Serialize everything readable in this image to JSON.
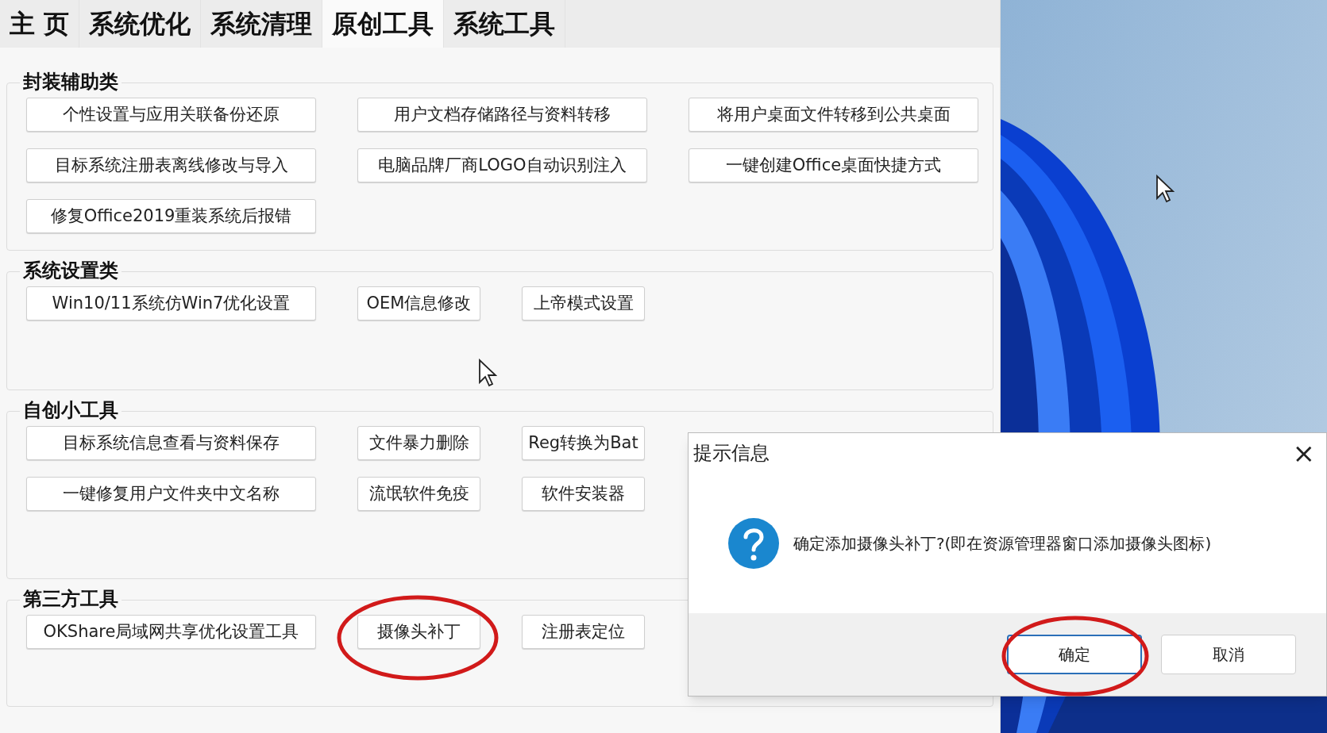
{
  "tabs": [
    {
      "label": "主 页",
      "selected": false
    },
    {
      "label": "系统优化",
      "selected": false
    },
    {
      "label": "系统清理",
      "selected": false
    },
    {
      "label": "原创工具",
      "selected": true
    },
    {
      "label": "系统工具",
      "selected": false
    }
  ],
  "sections": [
    {
      "title": "封装辅助类",
      "rows": [
        [
          {
            "label": "个性设置与应用关联备份还原",
            "kind": "wide"
          },
          {
            "label": "用户文档存储路径与资料转移",
            "kind": "wide"
          },
          {
            "label": "将用户桌面文件转移到公共桌面",
            "kind": "wide"
          }
        ],
        [
          {
            "label": "目标系统注册表离线修改与导入",
            "kind": "wide"
          },
          {
            "label": "电脑品牌厂商LOGO自动识别注入",
            "kind": "wide"
          },
          {
            "label": "一键创建Office桌面快捷方式",
            "kind": "wide"
          }
        ],
        [
          {
            "label": "修复Office2019重装系统后报错",
            "kind": "wide"
          }
        ]
      ]
    },
    {
      "title": "系统设置类",
      "rows": [
        [
          {
            "label": "Win10/11系统仿Win7优化设置",
            "kind": "wide"
          },
          {
            "label": "OEM信息修改",
            "kind": "narrow"
          },
          {
            "label": "上帝模式设置",
            "kind": "narrow"
          }
        ]
      ]
    },
    {
      "title": "自创小工具",
      "rows": [
        [
          {
            "label": "目标系统信息查看与资料保存",
            "kind": "wide"
          },
          {
            "label": "文件暴力删除",
            "kind": "narrow"
          },
          {
            "label": "Reg转换为Bat",
            "kind": "narrow"
          }
        ],
        [
          {
            "label": "一键修复用户文件夹中文名称",
            "kind": "wide"
          },
          {
            "label": "流氓软件免疫",
            "kind": "narrow"
          },
          {
            "label": "软件安装器",
            "kind": "narrow"
          }
        ]
      ]
    },
    {
      "title": "第三方工具",
      "rows": [
        [
          {
            "label": "OKShare局域网共享优化设置工具",
            "kind": "wide"
          },
          {
            "label": "摄像头补丁",
            "kind": "narrow"
          },
          {
            "label": "注册表定位",
            "kind": "narrow"
          }
        ]
      ]
    }
  ],
  "dialog": {
    "title": "提示信息",
    "close": "×",
    "message": "确定添加摄像头补丁?(即在资源管理器窗口添加摄像头图标)",
    "buttons": [
      {
        "label": "确定",
        "selected": true
      },
      {
        "label": "取消",
        "selected": false
      }
    ]
  }
}
